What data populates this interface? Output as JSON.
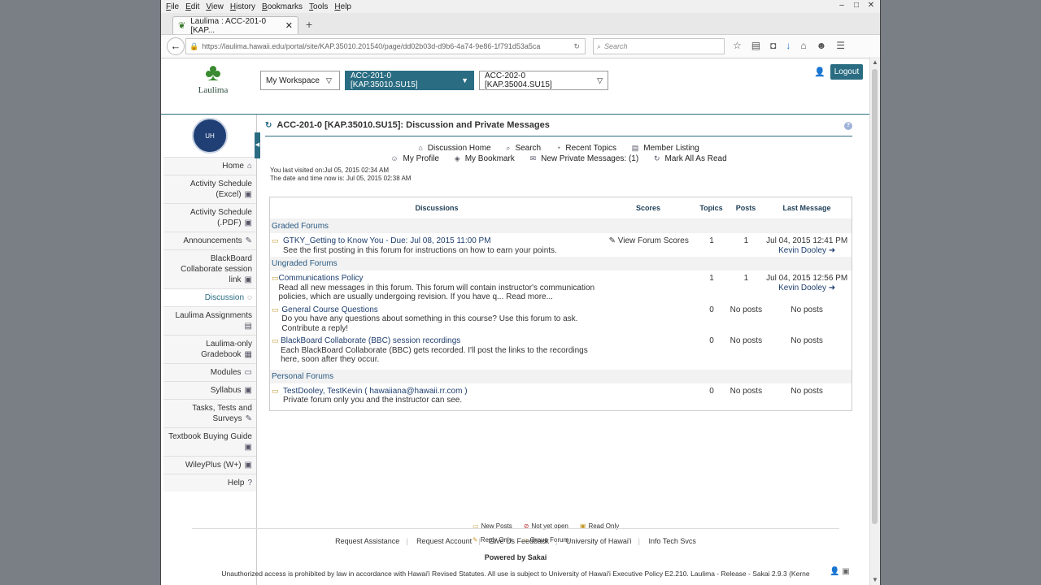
{
  "browser": {
    "menus": [
      "File",
      "Edit",
      "View",
      "History",
      "Bookmarks",
      "Tools",
      "Help"
    ],
    "tab_title": "Laulima : ACC-201-0 [KAP...",
    "url": "https://laulima.hawaii.edu/portal/site/KAP.35010.201540/page/dd02b03d-d9b6-4a74-9e86-1f791d53a5ca",
    "search_placeholder": "Search"
  },
  "header": {
    "logo_text": "Laulima",
    "sites": [
      "My Workspace",
      "ACC-201-0 [KAP.35010.SU15]",
      "ACC-202-0 [KAP.35004.SU15]"
    ],
    "logout": "Logout"
  },
  "sidebar": {
    "items": [
      {
        "label": "Home"
      },
      {
        "label": "Activity Schedule (Excel)"
      },
      {
        "label": "Activity Schedule (.PDF)"
      },
      {
        "label": "Announcements"
      },
      {
        "label": "BlackBoard Collaborate session link"
      },
      {
        "label": "Discussion"
      },
      {
        "label": "Laulima Assignments"
      },
      {
        "label": "Laulima-only Gradebook"
      },
      {
        "label": "Modules"
      },
      {
        "label": "Syllabus"
      },
      {
        "label": "Tasks, Tests and Surveys"
      },
      {
        "label": "Textbook Buying Guide"
      },
      {
        "label": "WileyPlus (W+)"
      },
      {
        "label": "Help"
      }
    ]
  },
  "main": {
    "title": "ACC-201-0 [KAP.35010.SU15]: Discussion and Private Messages",
    "toolbar1": [
      "Discussion Home",
      "Search",
      "Recent Topics",
      "Member Listing"
    ],
    "toolbar2": [
      "My Profile",
      "My Bookmark",
      "New Private Messages: (1)",
      "Mark All As Read"
    ],
    "last_visit": "You last visited on:Jul 05, 2015 02:34 AM",
    "now": "The date and time now is: Jul 05, 2015 02:38 AM",
    "columns": [
      "Discussions",
      "Scores",
      "Topics",
      "Posts",
      "Last Message"
    ],
    "groups": [
      {
        "name": "Graded Forums",
        "forums": [
          {
            "title": "GTKY_Getting to Know You - Due: Jul 08, 2015 11:00 PM",
            "desc": "See the first posting in this forum for instructions on how to earn your points.",
            "scores": "View Forum Scores",
            "topics": "1",
            "posts": "1",
            "last": "Jul 04, 2015 12:41 PM",
            "author": "Kevin Dooley"
          }
        ]
      },
      {
        "name": "Ungraded Forums",
        "forums": [
          {
            "title": "Communications Policy",
            "desc": "Read all new messages in this forum. This forum will contain instructor's communication policies, which are usually undergoing revision. If you have q... Read more...",
            "scores": "",
            "topics": "1",
            "posts": "1",
            "last": "Jul 04, 2015 12:56 PM",
            "author": "Kevin Dooley"
          },
          {
            "title": "General Course Questions",
            "desc": "Do you have any questions about something in this course? Use this forum to ask. Contribute a reply!",
            "scores": "",
            "topics": "0",
            "posts": "No posts",
            "last": "No posts",
            "author": ""
          },
          {
            "title": "BlackBoard Collaborate (BBC) session recordings",
            "desc": "Each BlackBoard Collaborate (BBC) gets recorded. I'll post the links to the recordings here, soon after they occur.",
            "scores": "",
            "topics": "0",
            "posts": "No posts",
            "last": "No posts",
            "author": ""
          }
        ]
      },
      {
        "name": "Personal Forums",
        "forums": [
          {
            "title": "TestDooley, TestKevin ( hawaiiana@hawaii.rr.com )",
            "desc": "Private forum only you and the instructor can see.",
            "scores": "",
            "topics": "0",
            "posts": "No posts",
            "last": "No posts",
            "author": ""
          }
        ]
      }
    ],
    "legend": [
      "New Posts",
      "Not yet open",
      "Read Only",
      "Reply Only",
      "Group Forum"
    ]
  },
  "footer": {
    "links": [
      "Request Assistance",
      "Request Account",
      "Give Us Feedback",
      "University of Hawai'i",
      "Info Tech Svcs"
    ],
    "powered": "Powered by Sakai",
    "disclaimer": "Unauthorized access is prohibited by law in accordance with Hawai'i Revised Statutes. All use is subject to University of Hawai'i Executive Policy E2.210. Laulima - Release - Sakai 2.9.3 (Kerne"
  }
}
